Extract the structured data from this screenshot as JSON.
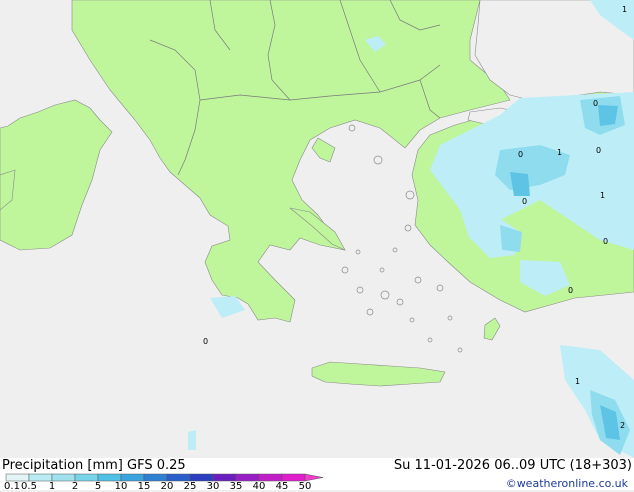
{
  "title": "Precipitation [mm]",
  "model": "GFS 0.25",
  "valid_time": "Su 11-01-2026 06..09 UTC (18+303)",
  "credit": "©weatheronline.co.uk",
  "legend": {
    "ticks": [
      "0.1",
      "0.5",
      "1",
      "2",
      "5",
      "10",
      "15",
      "20",
      "25",
      "30",
      "35",
      "40",
      "45",
      "50"
    ],
    "colors": [
      "#e2f4f5",
      "#b8ecf2",
      "#9fe2ee",
      "#79d4ea",
      "#4ec1e4",
      "#3ba3de",
      "#2e80d2",
      "#2a5ecb",
      "#2a3fc0",
      "#6a1ec0",
      "#9a1ec8",
      "#c21ec8",
      "#e01ecc",
      "#f03ec8"
    ]
  },
  "colors": {
    "land": "#bff59b",
    "sea": "#efefef",
    "precip_light": "#bdeef7",
    "precip_mid": "#8fdcee",
    "precip_heavy": "#5ec4e6",
    "border": "#7a7a7a"
  },
  "map_labels": [
    {
      "text": "1"
    },
    {
      "text": "0"
    },
    {
      "text": "0"
    },
    {
      "text": "1"
    },
    {
      "text": "0"
    },
    {
      "text": "0"
    },
    {
      "text": "1"
    },
    {
      "text": "0"
    },
    {
      "text": "0"
    },
    {
      "text": "0"
    },
    {
      "text": "1"
    },
    {
      "text": "2"
    }
  ]
}
